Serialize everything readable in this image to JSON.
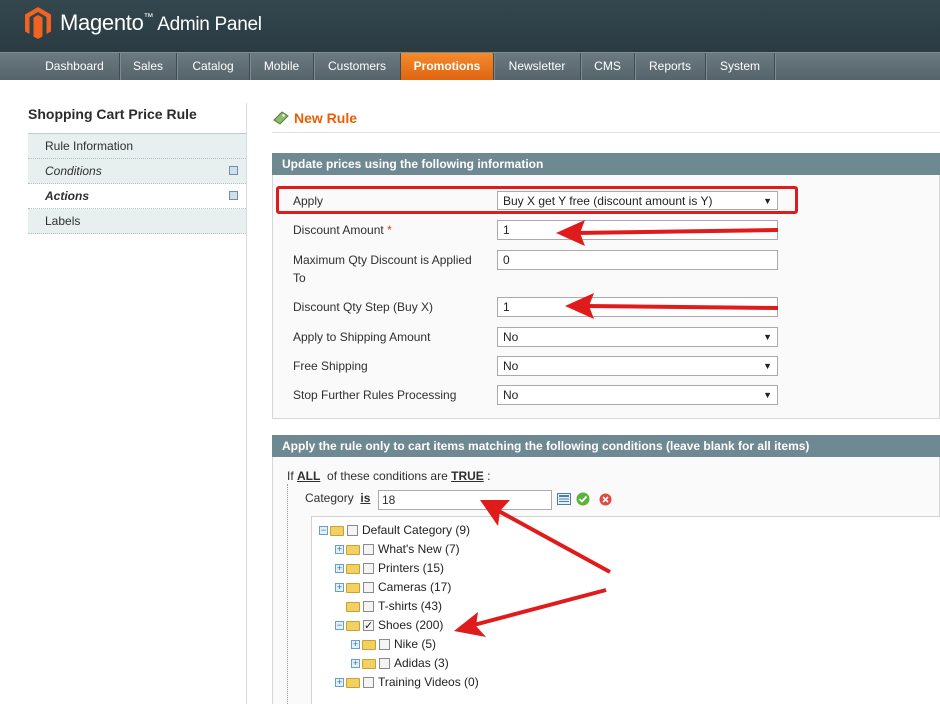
{
  "header": {
    "brand": "Magento",
    "trademark": "™",
    "subtitle": "Admin Panel"
  },
  "nav": {
    "items": [
      "Dashboard",
      "Sales",
      "Catalog",
      "Mobile",
      "Customers",
      "Promotions",
      "Newsletter",
      "CMS",
      "Reports",
      "System"
    ],
    "active": "Promotions"
  },
  "sidebar": {
    "title": "Shopping Cart Price Rule",
    "items": [
      {
        "label": "Rule Information"
      },
      {
        "label": "Conditions"
      },
      {
        "label": "Actions"
      },
      {
        "label": "Labels"
      }
    ]
  },
  "page": {
    "title": "New Rule"
  },
  "actions_fieldset": {
    "legend": "Update prices using the following information",
    "apply_label": "Apply",
    "apply_value": "Buy X get Y free (discount amount is Y)",
    "discount_amount_label": "Discount Amount",
    "required_mark": "*",
    "discount_amount_value": "1",
    "max_qty_label": "Maximum Qty Discount is Applied To",
    "max_qty_value": "0",
    "qty_step_label": "Discount Qty Step (Buy X)",
    "qty_step_value": "1",
    "shipping_label": "Apply to Shipping Amount",
    "shipping_value": "No",
    "free_shipping_label": "Free Shipping",
    "free_shipping_value": "No",
    "stop_rules_label": "Stop Further Rules Processing",
    "stop_rules_value": "No"
  },
  "conditions_fieldset": {
    "legend": "Apply the rule only to cart items matching the following conditions (leave blank for all items)",
    "if_text": "If",
    "all": "ALL",
    "of_text": "of these conditions are",
    "true": "TRUE",
    "colon": ":",
    "category_label": "Category",
    "is": "is",
    "category_value": "18"
  },
  "tree": [
    {
      "label": "Default Category (9)",
      "checked": false
    },
    {
      "label": "What's New (7)",
      "checked": false
    },
    {
      "label": "Printers (15)",
      "checked": false
    },
    {
      "label": "Cameras (17)",
      "checked": false
    },
    {
      "label": "T-shirts (43)",
      "checked": false
    },
    {
      "label": "Shoes (200)",
      "checked": true
    },
    {
      "label": "Nike (5)",
      "checked": false
    },
    {
      "label": "Adidas (3)",
      "checked": false
    },
    {
      "label": "Training Videos (0)",
      "checked": false
    }
  ],
  "colors": {
    "accent": "#eb5e00",
    "nav_active": "#f07a1e",
    "fieldset_header": "#6f8992",
    "annotation": "#e01b1b"
  }
}
